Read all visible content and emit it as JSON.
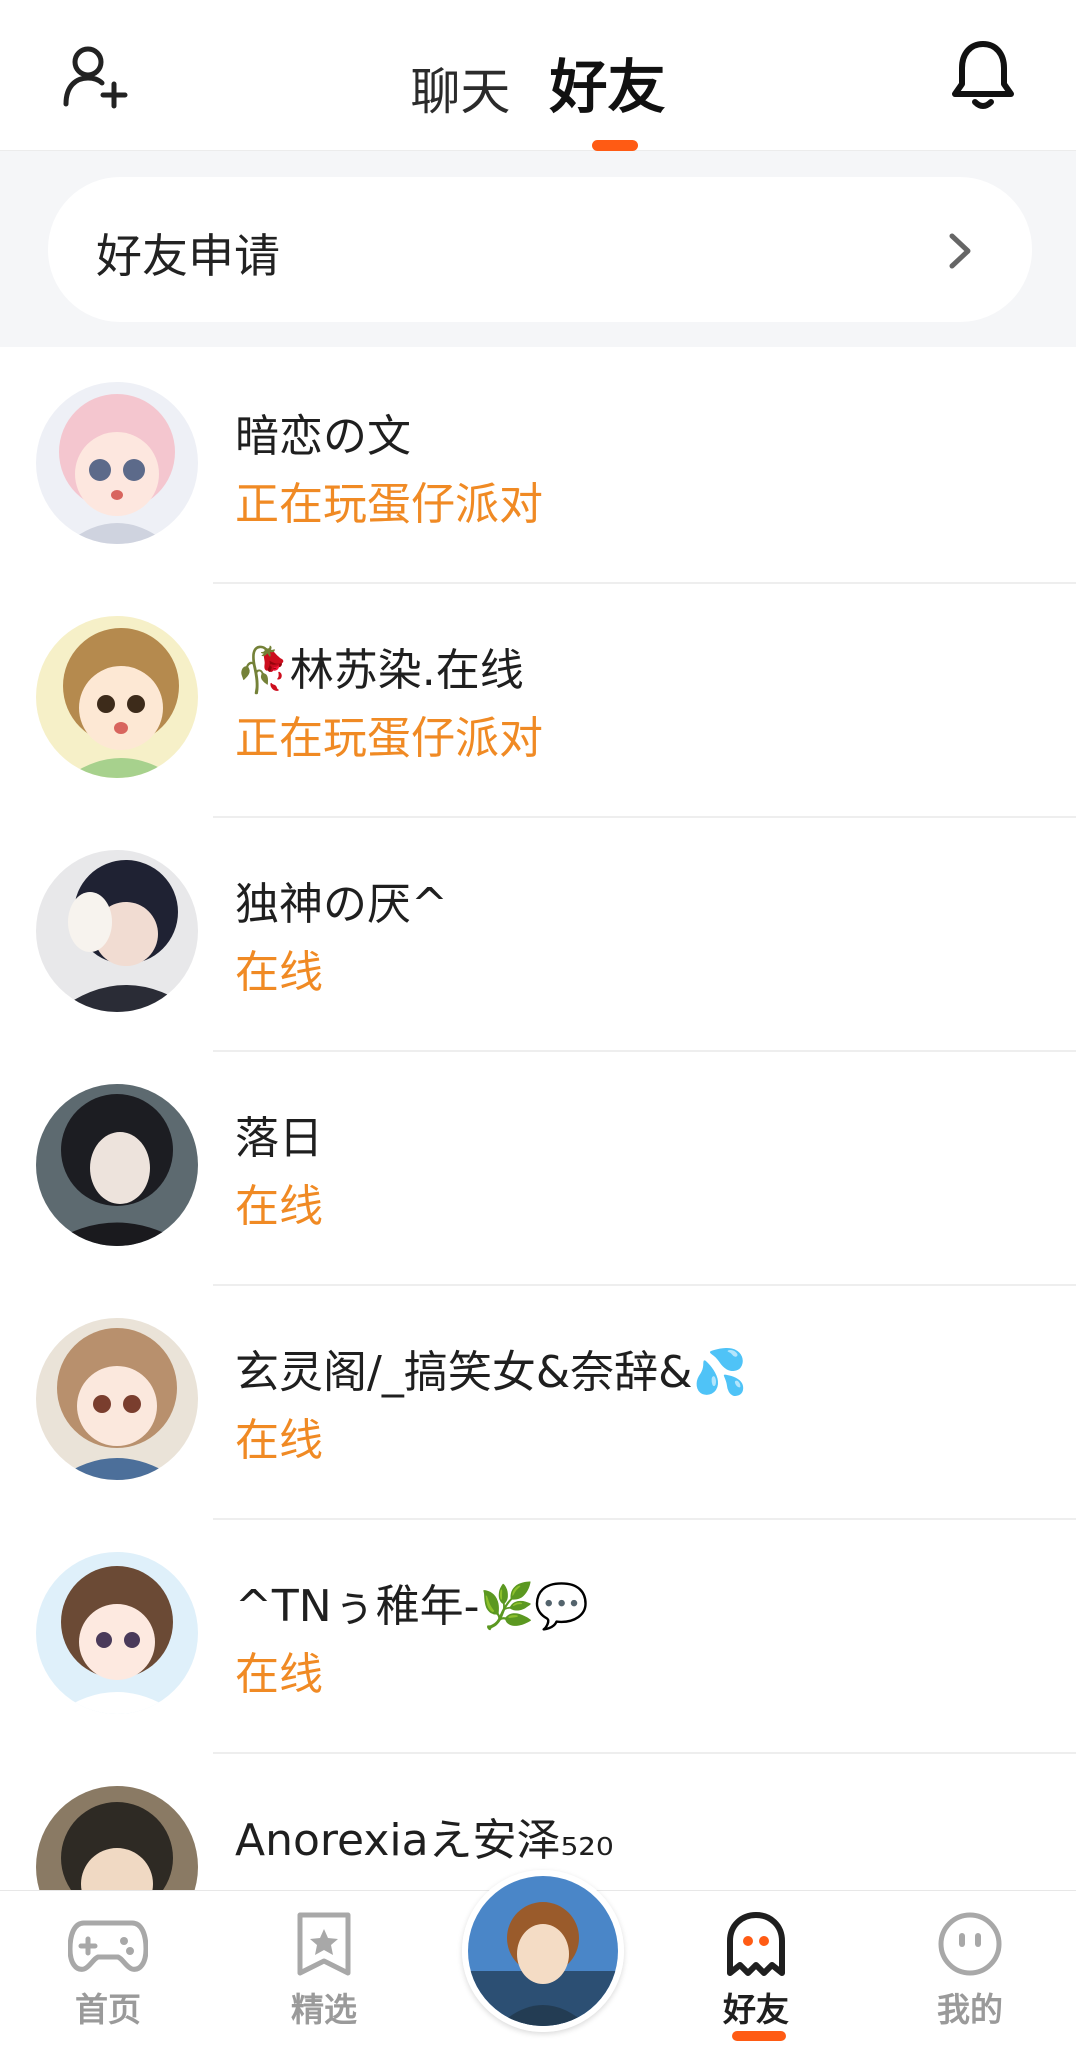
{
  "header": {
    "tabs": [
      {
        "label": "聊天",
        "active": false
      },
      {
        "label": "好友",
        "active": true
      }
    ],
    "left_icon": "add-friend-icon",
    "right_icon": "bell-icon",
    "accent_color": "#ff5b14"
  },
  "friend_request": {
    "label": "好友申请",
    "icon": "chevron-right-icon"
  },
  "friends": [
    {
      "name": "暗恋の文",
      "status": "正在玩蛋仔派对"
    },
    {
      "name": "🥀林苏染.在线",
      "status": "正在玩蛋仔派对"
    },
    {
      "name": "独神の厌^",
      "status": "在线"
    },
    {
      "name": "落日",
      "status": "在线"
    },
    {
      "name": "玄灵阁/_搞笑女&奈辞&💦",
      "status": "在线"
    },
    {
      "name": "^TNぅ稚年-🌿💬",
      "status": "在线"
    },
    {
      "name": "Anorexiaえ安泽₅₂₀",
      "status": ""
    }
  ],
  "status_color": "#f08a24",
  "bottom_nav": {
    "items": [
      {
        "label": "首页",
        "icon": "gamepad-icon",
        "active": false
      },
      {
        "label": "精选",
        "icon": "star-bookmark-icon",
        "active": false
      },
      {
        "label": "好友",
        "icon": "ghost-icon",
        "active": true
      },
      {
        "label": "我的",
        "icon": "face-icon",
        "active": false
      }
    ]
  }
}
